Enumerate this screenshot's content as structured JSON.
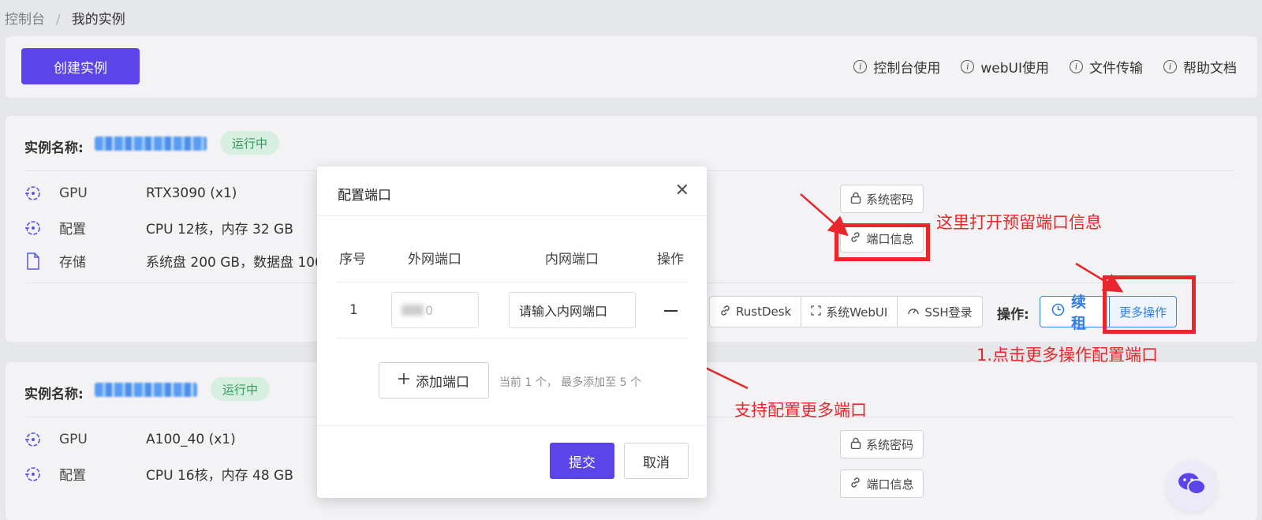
{
  "breadcrumb": {
    "root": "控制台",
    "separator": "/",
    "current": "我的实例"
  },
  "toolbar": {
    "create_label": "创建实例",
    "help_links": [
      "控制台使用",
      "webUI使用",
      "文件传输",
      "帮助文档"
    ]
  },
  "instances": [
    {
      "name_label": "实例名称:",
      "status": "运行中",
      "specs": [
        {
          "icon": "gpu-icon",
          "label": "GPU",
          "value": "RTX3090 (x1)"
        },
        {
          "icon": "cpu-icon",
          "label": "配置",
          "value": "CPU 12核，内存 32 GB"
        },
        {
          "icon": "file-icon",
          "label": "存储",
          "value": "系统盘 200 GB，数据盘 100"
        }
      ],
      "sys_password": "系统密码",
      "port_info": "端口信息",
      "connect": [
        "RustDesk",
        "系统WebUI",
        "SSH登录"
      ],
      "op_label": "操作:",
      "renew": "续租",
      "more": "更多操作"
    },
    {
      "name_label": "实例名称:",
      "status": "运行中",
      "specs": [
        {
          "icon": "gpu-icon",
          "label": "GPU",
          "value": "A100_40 (x1)"
        },
        {
          "icon": "cpu-icon",
          "label": "配置",
          "value": "CPU 16核，内存 48 GB"
        }
      ],
      "sys_password": "系统密码",
      "port_info": "端口信息"
    }
  ],
  "modal": {
    "title": "配置端口",
    "columns": [
      "序号",
      "外网端口",
      "内网端口",
      "操作"
    ],
    "rows": [
      {
        "no": "1",
        "external": "0",
        "internal_placeholder": "请输入内网端口"
      }
    ],
    "add_label": "添加端口",
    "hint": "当前 1 个， 最多添加至 5 个",
    "submit": "提交",
    "cancel": "取消"
  },
  "annotations": {
    "port_info_note": "这里打开预留端口信息",
    "more_ops_note": "1.点击更多操作配置端口",
    "add_more_note": "支持配置更多端口"
  },
  "colors": {
    "primary": "#5b44e8",
    "link": "#2f7de8",
    "status_bg": "#d7efe0",
    "status_fg": "#2e9a57",
    "annotation": "#e8262b"
  }
}
